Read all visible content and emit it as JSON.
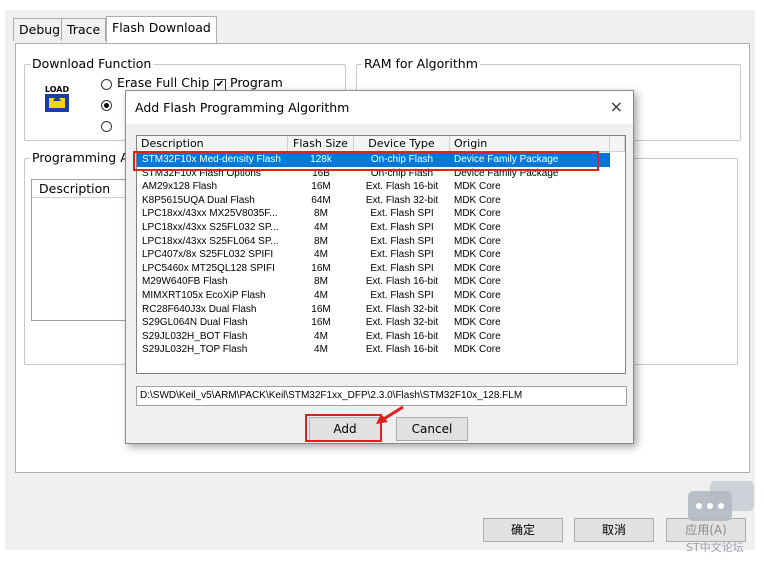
{
  "tabs": [
    {
      "label": "Debug"
    },
    {
      "label": "Trace"
    },
    {
      "label": "Flash Download"
    }
  ],
  "download_function": {
    "title": "Download Function",
    "load_label": "LOAD",
    "erase_full_chip": "Erase Full Chip",
    "program": "Program",
    "program_checked": true,
    "check_mark": "✔"
  },
  "ram_for_algorithm": {
    "title": "RAM for Algorithm"
  },
  "programming_algorithm": {
    "title": "Programming Al",
    "description_header": "Description"
  },
  "dialog": {
    "title": "Add Flash Programming Algorithm",
    "close": "×",
    "columns": [
      "Description",
      "Flash Size",
      "Device Type",
      "Origin"
    ],
    "rows": [
      {
        "description": "STM32F10x Med-density Flash",
        "size": "128k",
        "type": "On-chip Flash",
        "origin": "Device Family Package",
        "selected": true
      },
      {
        "description": "STM32F10x Flash Options",
        "size": "16B",
        "type": "On-chip Flash",
        "origin": "Device Family Package"
      },
      {
        "description": "AM29x128 Flash",
        "size": "16M",
        "type": "Ext. Flash 16-bit",
        "origin": "MDK Core"
      },
      {
        "description": "K8P5615UQA Dual Flash",
        "size": "64M",
        "type": "Ext. Flash 32-bit",
        "origin": "MDK Core"
      },
      {
        "description": "LPC18xx/43xx MX25V8035F...",
        "size": "8M",
        "type": "Ext. Flash SPI",
        "origin": "MDK Core"
      },
      {
        "description": "LPC18xx/43xx S25FL032 SP...",
        "size": "4M",
        "type": "Ext. Flash SPI",
        "origin": "MDK Core"
      },
      {
        "description": "LPC18xx/43xx S25FL064 SP...",
        "size": "8M",
        "type": "Ext. Flash SPI",
        "origin": "MDK Core"
      },
      {
        "description": "LPC407x/8x S25FL032 SPIFI",
        "size": "4M",
        "type": "Ext. Flash SPI",
        "origin": "MDK Core"
      },
      {
        "description": "LPC5460x MT25QL128 SPIFI",
        "size": "16M",
        "type": "Ext. Flash SPI",
        "origin": "MDK Core"
      },
      {
        "description": "M29W640FB Flash",
        "size": "8M",
        "type": "Ext. Flash 16-bit",
        "origin": "MDK Core"
      },
      {
        "description": "MIMXRT105x EcoXiP Flash",
        "size": "4M",
        "type": "Ext. Flash SPI",
        "origin": "MDK Core"
      },
      {
        "description": "RC28F640J3x Dual Flash",
        "size": "16M",
        "type": "Ext. Flash 32-bit",
        "origin": "MDK Core"
      },
      {
        "description": "S29GL064N Dual Flash",
        "size": "16M",
        "type": "Ext. Flash 32-bit",
        "origin": "MDK Core"
      },
      {
        "description": "S29JL032H_BOT Flash",
        "size": "4M",
        "type": "Ext. Flash 16-bit",
        "origin": "MDK Core"
      },
      {
        "description": "S29JL032H_TOP Flash",
        "size": "4M",
        "type": "Ext. Flash 16-bit",
        "origin": "MDK Core"
      }
    ],
    "path": "D:\\SWD\\Keil_v5\\ARM\\PACK\\Keil\\STM32F1xx_DFP\\2.3.0\\Flash\\STM32F10x_128.FLM",
    "add_label": "Add",
    "cancel_label": "Cancel"
  },
  "footer": {
    "ok_label": "确定",
    "cancel_label": "取消",
    "apply_label": "应用(A)"
  },
  "watermark": "ST中文论坛",
  "colors": {
    "selection": "#0078d7",
    "highlight_red": "#e0201c"
  }
}
